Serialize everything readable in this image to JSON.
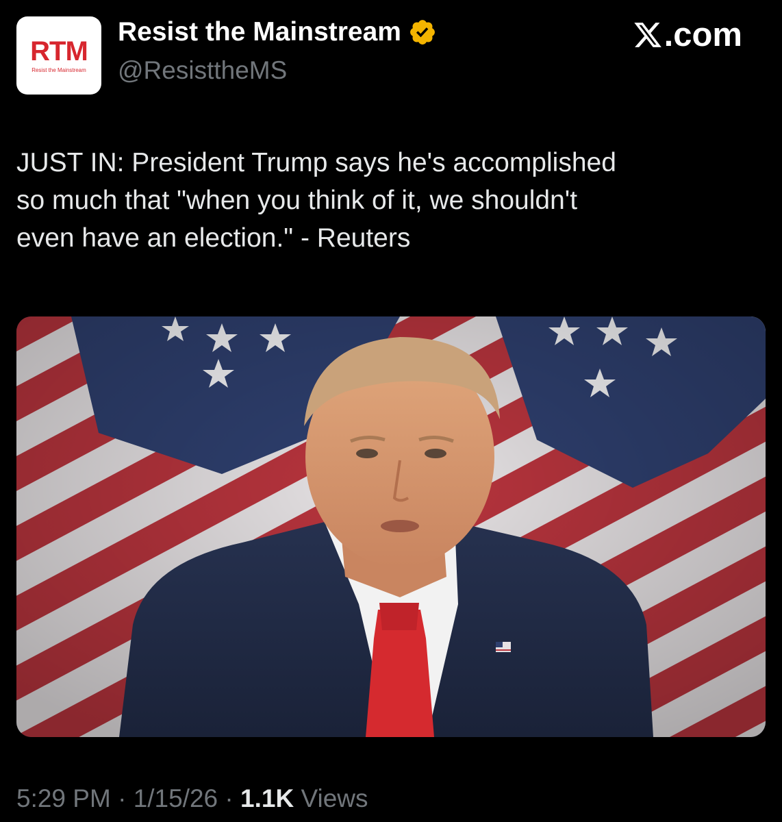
{
  "author": {
    "avatar_logo": "RTM",
    "avatar_subtitle": "Resist the Mainstream",
    "name": "Resist the Mainstream",
    "verified_icon": "verified-badge-icon",
    "verified_color": "#f4b400",
    "handle": "@ResisttheMS"
  },
  "site": {
    "logo_icon": "x-logo-icon",
    "domain_suffix": ".com"
  },
  "tweet": {
    "text": "JUST IN: President Trump says he's accomplished\nso much that \"when you think of it, we shouldn't\neven have an election.\" - Reuters"
  },
  "media": {
    "type": "photo"
  },
  "meta": {
    "time": "5:29 PM",
    "date": "1/15/26",
    "separator": " · ",
    "views_count": "1.1K",
    "views_label": " Views"
  },
  "colors": {
    "background": "#000000",
    "text_primary": "#e7e9ea",
    "text_secondary": "#71767b",
    "brand_red": "#d7262e"
  }
}
